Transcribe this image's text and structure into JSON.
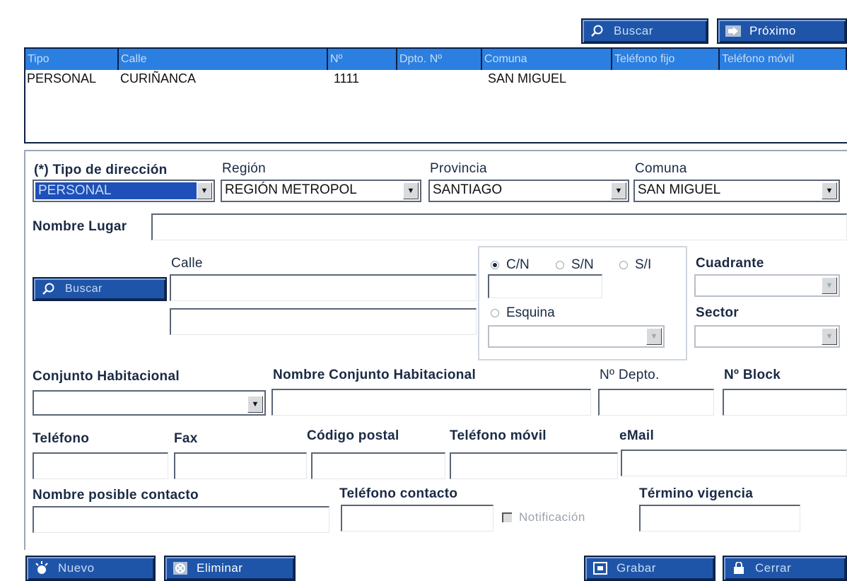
{
  "toolbar_top": {
    "buscar_label": "Buscar",
    "proximo_label": "Próximo"
  },
  "grid": {
    "columns": [
      "Tipo",
      "Calle",
      "Nº",
      "Dpto. Nº",
      "Comuna",
      "Teléfono fijo",
      "Teléfono móvil"
    ],
    "rows": [
      {
        "tipo": "PERSONAL",
        "calle": "CURIÑANCA",
        "numero": "1111",
        "dpto": "",
        "comuna": "SAN MIGUEL",
        "tel_fijo": "",
        "tel_movil": ""
      }
    ]
  },
  "form": {
    "tipo_direccion": {
      "label": "(*) Tipo de dirección",
      "value": "PERSONAL"
    },
    "region": {
      "label": "Región",
      "value": "REGIÓN METROPOL"
    },
    "provincia": {
      "label": "Provincia",
      "value": "SANTIAGO"
    },
    "comuna": {
      "label": "Comuna",
      "value": "SAN MIGUEL"
    },
    "nombre_lugar": {
      "label": "Nombre Lugar",
      "value": ""
    },
    "calle": {
      "label": "Calle",
      "buscar_label": "Buscar",
      "value1": "",
      "value2": ""
    },
    "numeracion": {
      "options": [
        "C/N",
        "S/N",
        "S/I"
      ],
      "selected": "C/N",
      "esquina_label": "Esquina"
    },
    "cuadrante": {
      "label": "Cuadrante",
      "value": ""
    },
    "sector": {
      "label": "Sector",
      "value": ""
    },
    "conjunto_habitacional": {
      "label": "Conjunto Habitacional",
      "value": ""
    },
    "nombre_conjunto": {
      "label": "Nombre Conjunto Habitacional",
      "value": ""
    },
    "no_depto": {
      "label": "Nº Depto.",
      "value": ""
    },
    "no_block": {
      "label": "Nº Block",
      "value": ""
    },
    "telefono": {
      "label": "Teléfono",
      "value": ""
    },
    "fax": {
      "label": "Fax",
      "value": ""
    },
    "codigo_postal": {
      "label": "Código postal",
      "value": ""
    },
    "telefono_movil": {
      "label": "Teléfono móvil",
      "value": ""
    },
    "email": {
      "label": "eMail",
      "value": ""
    },
    "nombre_contacto": {
      "label": "Nombre posible contacto",
      "value": ""
    },
    "telefono_contacto": {
      "label": "Teléfono contacto",
      "value": ""
    },
    "notificacion": {
      "label": "Notificación",
      "checked": false
    },
    "termino_vigencia": {
      "label": "Término vigencia",
      "value": ""
    }
  },
  "toolbar_bottom": {
    "nuevo_label": "Nuevo",
    "eliminar_label": "Eliminar",
    "grabar_label": "Grabar",
    "cerrar_label": "Cerrar"
  },
  "colors": {
    "button_blue": "#1f55a8",
    "header_blue": "#2b7fe0",
    "selection_blue": "#1f4fb8"
  }
}
